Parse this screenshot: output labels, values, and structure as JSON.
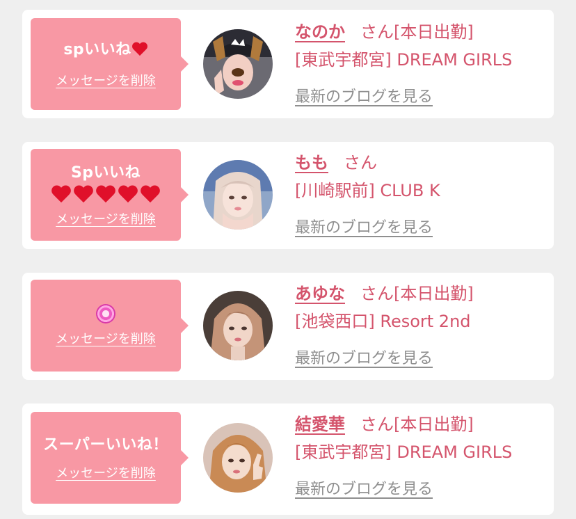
{
  "accent_color": "#f898a4",
  "text_color": "#d4546c",
  "link_gray": "#8f8f8f",
  "cards": [
    {
      "reaction": "spいいね",
      "reaction_emoji": "red-heart",
      "delete_label": "メッセージを削除",
      "name": "なのか",
      "suffix": "さん[本日出勤]",
      "shop": "[東武宇都宮] DREAM GIRLS",
      "blog_label": "最新のブログを見る",
      "avatar_icon": "photo-avatar-dog-filter"
    },
    {
      "reaction": "Spいいね",
      "reaction_hearts": 5,
      "delete_label": "メッセージを削除",
      "name": "もも",
      "suffix": "さん",
      "shop": "[川崎駅前] CLUB K",
      "blog_label": "最新のブログを見る",
      "avatar_icon": "photo-avatar"
    },
    {
      "reaction_emoji": "sparkling-pink-heart",
      "delete_label": "メッセージを削除",
      "name": "あゆな",
      "suffix": "さん[本日出勤]",
      "shop": "[池袋西口] Resort 2nd",
      "blog_label": "最新のブログを見る",
      "avatar_icon": "photo-avatar"
    },
    {
      "reaction": "スーパーいいね！",
      "delete_label": "メッセージを削除",
      "name": "結愛華",
      "suffix": "さん[本日出勤]",
      "shop": "[東武宇都宮] DREAM GIRLS",
      "blog_label": "最新のブログを見る",
      "avatar_icon": "photo-avatar"
    }
  ]
}
